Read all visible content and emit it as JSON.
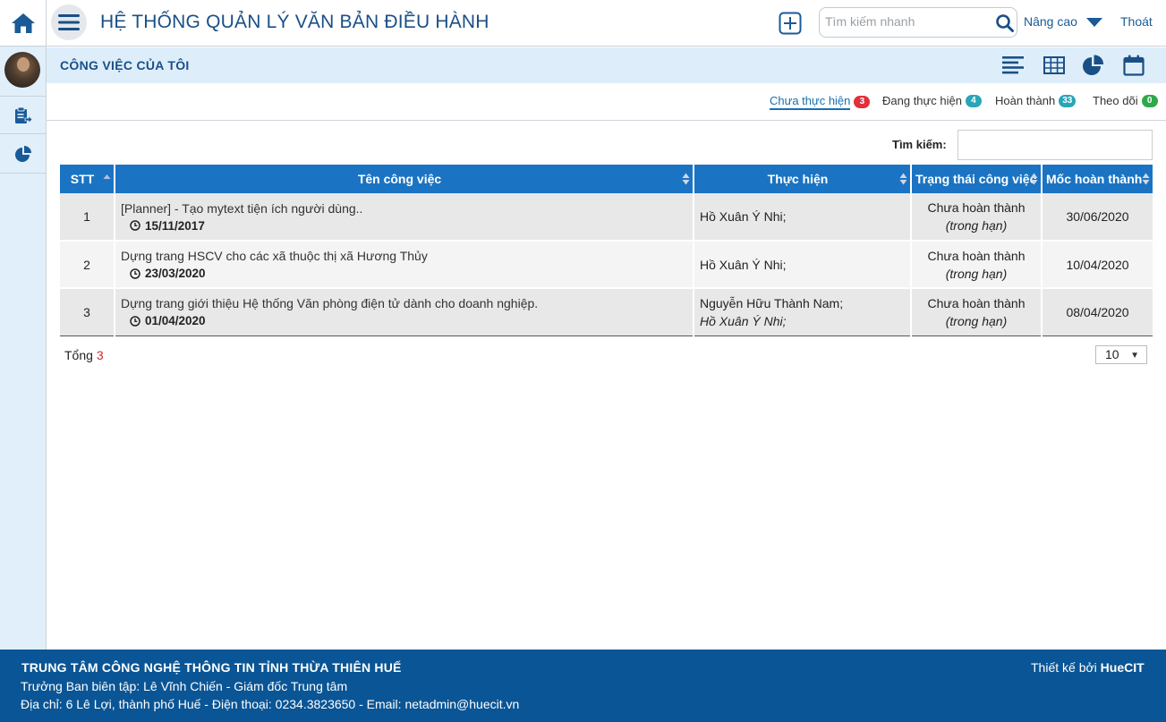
{
  "header": {
    "title": "HỆ THỐNG QUẢN LÝ VĂN BẢN ĐIỀU HÀNH",
    "search_placeholder": "Tìm kiếm nhanh",
    "advanced_label": "Nâng cao",
    "logout_label": "Thoát"
  },
  "colors": {
    "primary": "#1b74c3",
    "header_text": "#1a4f86",
    "footer_bg": "#0a5595",
    "sidebar_bg": "#e0effa"
  },
  "sidebar": {
    "icons": [
      "avatar",
      "clipboard-export-icon",
      "pie-chart-icon"
    ]
  },
  "section": {
    "title": "CÔNG VIỆC CỦA TÔI",
    "view_icons": [
      "list-view-icon",
      "table-view-icon",
      "chart-view-icon",
      "calendar-view-icon"
    ]
  },
  "tabs": [
    {
      "label": "Chưa thực hiện",
      "count": "3"
    },
    {
      "label": "Đang thực hiện",
      "count": "4"
    },
    {
      "label": "Hoàn thành",
      "count": "33"
    },
    {
      "label": "Theo dõi",
      "count": "0"
    }
  ],
  "table": {
    "search_label": "Tìm kiếm:",
    "columns": [
      "STT",
      "Tên công việc",
      "Thực hiện",
      "Trạng thái công việc",
      "Mốc hoàn thành"
    ],
    "rows": [
      {
        "stt": "1",
        "title": "[Planner] - Tạo mytext tiện ích người dùng..",
        "date": "15/11/2017",
        "exec": [
          "Hồ Xuân Ý Nhi;"
        ],
        "status": "Chưa hoàn thành",
        "status_note": "(trong hạn)",
        "due": "30/06/2020"
      },
      {
        "stt": "2",
        "title": "Dựng trang HSCV cho các xã thuộc thị xã Hương Thủy",
        "date": "23/03/2020",
        "exec": [
          "Hồ Xuân Ý Nhi;"
        ],
        "status": "Chưa hoàn thành",
        "status_note": "(trong hạn)",
        "due": "10/04/2020"
      },
      {
        "stt": "3",
        "title": "Dựng trang giới thiệu Hệ thống Văn phòng điện tử dành cho doanh nghiệp.",
        "date": "01/04/2020",
        "exec": [
          "Nguyễn Hữu Thành Nam;",
          "Hồ Xuân Ý Nhi;"
        ],
        "status": "Chưa hoàn thành",
        "status_note": "(trong hạn)",
        "due": "08/04/2020"
      }
    ],
    "total_label": "Tổng",
    "total_value": "3",
    "page_size": "10"
  },
  "footer": {
    "org": "TRUNG TÂM CÔNG NGHỆ THÔNG TIN TỈNH THỪA THIÊN HUẾ",
    "editor": "Trưởng Ban biên tập: Lê Vĩnh Chiến - Giám đốc Trung tâm",
    "address": "Địa chỉ: 6 Lê Lợi, thành phố Huế - Điện thoại: 0234.3823650 - Email: netadmin@huecit.vn",
    "design_prefix": "Thiết kế bởi",
    "design_brand": "HueCIT"
  }
}
